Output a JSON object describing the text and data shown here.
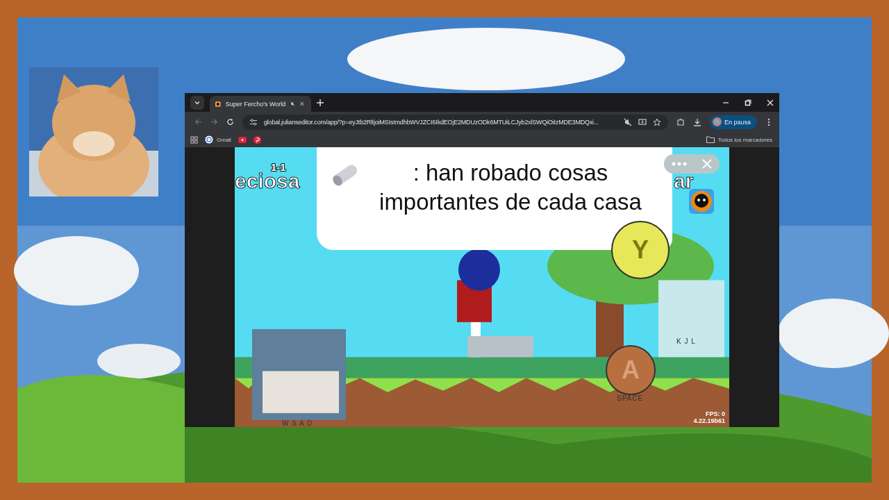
{
  "browser": {
    "tabs": [
      {
        "title": "Super Fercho's World",
        "selected": true
      }
    ],
    "url": "global.julianseditor.com/app/?p=eyJtb2RlIjoiMSIsImdhbWVJZCI6IkdEOjE2MDUzODk6MTUiLCJyb2xlSWQiOiIzMDE3MDQxi...",
    "profile": "En pausa",
    "bookmarks": [
      {
        "label": "Gmail"
      }
    ],
    "all_bookmarks": "Todos los marcadores"
  },
  "game": {
    "level": "1-1",
    "title_left": "eciosa",
    "title_right": "ar",
    "dialogue": ": han robado cosas importantes de cada casa",
    "buttons": [
      {
        "label": "Y"
      },
      {
        "label": "A"
      }
    ],
    "controls": [
      {
        "label": "W S A D"
      },
      {
        "label": "SPACE"
      },
      {
        "label": "K J L"
      }
    ],
    "fps": "FPS: 0",
    "version": "4.22.19b61"
  }
}
